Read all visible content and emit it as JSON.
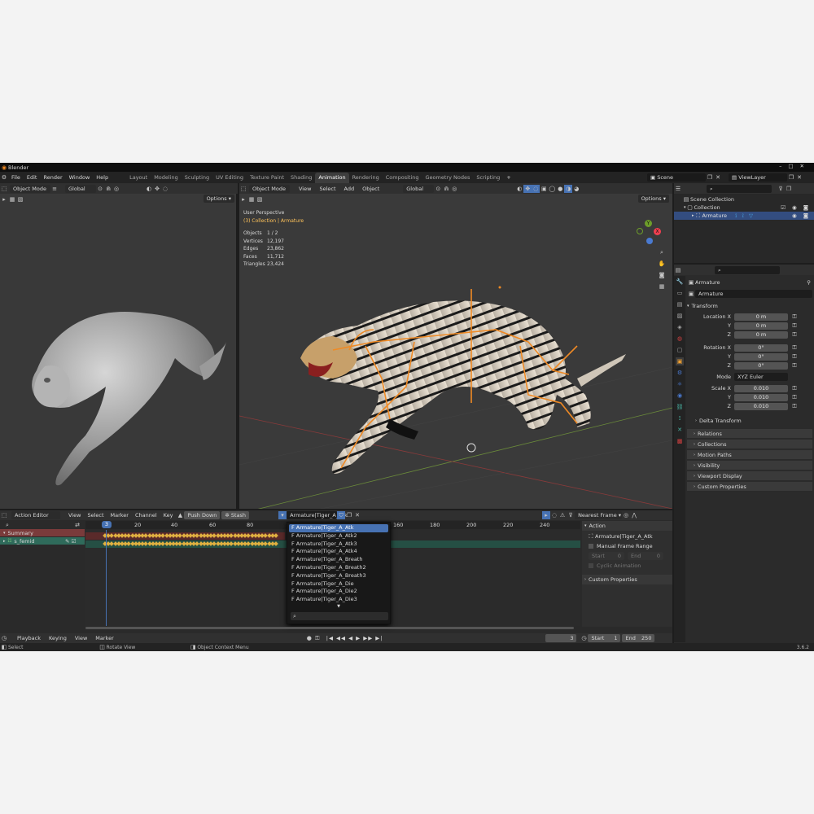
{
  "app": {
    "title": "Blender",
    "version": "3.6.2"
  },
  "menu": [
    "File",
    "Edit",
    "Render",
    "Window",
    "Help"
  ],
  "workspaces": [
    "Layout",
    "Modeling",
    "Sculpting",
    "UV Editing",
    "Texture Paint",
    "Shading",
    "Animation",
    "Rendering",
    "Compositing",
    "Geometry Nodes",
    "Scripting"
  ],
  "active_workspace": "Animation",
  "scene": "Scene",
  "view_layer": "ViewLayer",
  "left_view": {
    "mode": "Object Mode",
    "orientation": "Global",
    "options": "Options"
  },
  "main_view": {
    "mode": "Object Mode",
    "menus": [
      "View",
      "Select",
      "Add",
      "Object"
    ],
    "orientation": "Global",
    "options": "Options",
    "perspective": "User Perspective",
    "collection": "(3) Collection | Armature",
    "stats": [
      {
        "k": "Objects",
        "v": "1 / 2"
      },
      {
        "k": "Vertices",
        "v": "12,197"
      },
      {
        "k": "Edges",
        "v": "23,862"
      },
      {
        "k": "Faces",
        "v": "11,712"
      },
      {
        "k": "Triangles",
        "v": "23,424"
      }
    ],
    "gizmo": {
      "x": "X",
      "y": "Y",
      "z": "Z"
    }
  },
  "outliner": {
    "root": "Scene Collection",
    "collection": "Collection",
    "object": "Armature"
  },
  "properties": {
    "object": "Armature",
    "name": "Armature",
    "transform": "Transform",
    "location_label": "Location X",
    "loc": [
      "0 m",
      "0 m",
      "0 m"
    ],
    "rotation_label": "Rotation X",
    "rot": [
      "0°",
      "0°",
      "0°"
    ],
    "mode_label": "Mode",
    "mode": "XYZ Euler",
    "scale_label": "Scale X",
    "scale": [
      "0.010",
      "0.010",
      "0.010"
    ],
    "y": "Y",
    "z": "Z",
    "delta": "Delta Transform",
    "sections": [
      "Relations",
      "Collections",
      "Motion Paths",
      "Visibility",
      "Viewport Display",
      "Custom Properties"
    ]
  },
  "action_editor": {
    "editor": "Action Editor",
    "menus": [
      "View",
      "Select",
      "Marker",
      "Channel",
      "Key"
    ],
    "push_down": "Push Down",
    "stash": "Stash",
    "action": "Armature|Tiger_A_Atk",
    "snap": "Nearest Frame",
    "current_frame": "3",
    "ruler": [
      "20",
      "40",
      "60",
      "80",
      "160",
      "180",
      "200",
      "220",
      "240"
    ],
    "summary": "Summary",
    "channel": "s_femid",
    "dropdown": [
      "F Armature|Tiger_A_Atk",
      "F Armature|Tiger_A_Atk2",
      "F Armature|Tiger_A_Atk3",
      "F Armature|Tiger_A_Atk4",
      "F Armature|Tiger_A_Breath",
      "F Armature|Tiger_A_Breath2",
      "F Armature|Tiger_A_Breath3",
      "F Armature|Tiger_A_Die",
      "F Armature|Tiger_A_Die2",
      "F Armature|Tiger_A_Die3"
    ],
    "action_panel": "Action",
    "action_name": "Armature|Tiger_A_Atk",
    "manual_range": "Manual Frame Range",
    "start": "Start",
    "start_v": "0",
    "end": "End",
    "end_v": "0",
    "cyclic": "Cyclic Animation",
    "custom": "Custom Properties"
  },
  "timeline": {
    "menus": [
      "Playback",
      "Keying",
      "View",
      "Marker"
    ],
    "frame": "3",
    "start_label": "Start",
    "start": "1",
    "end_label": "End",
    "end": "250"
  },
  "status": {
    "select": "Select",
    "rotate": "Rotate View",
    "context": "Object Context Menu"
  }
}
